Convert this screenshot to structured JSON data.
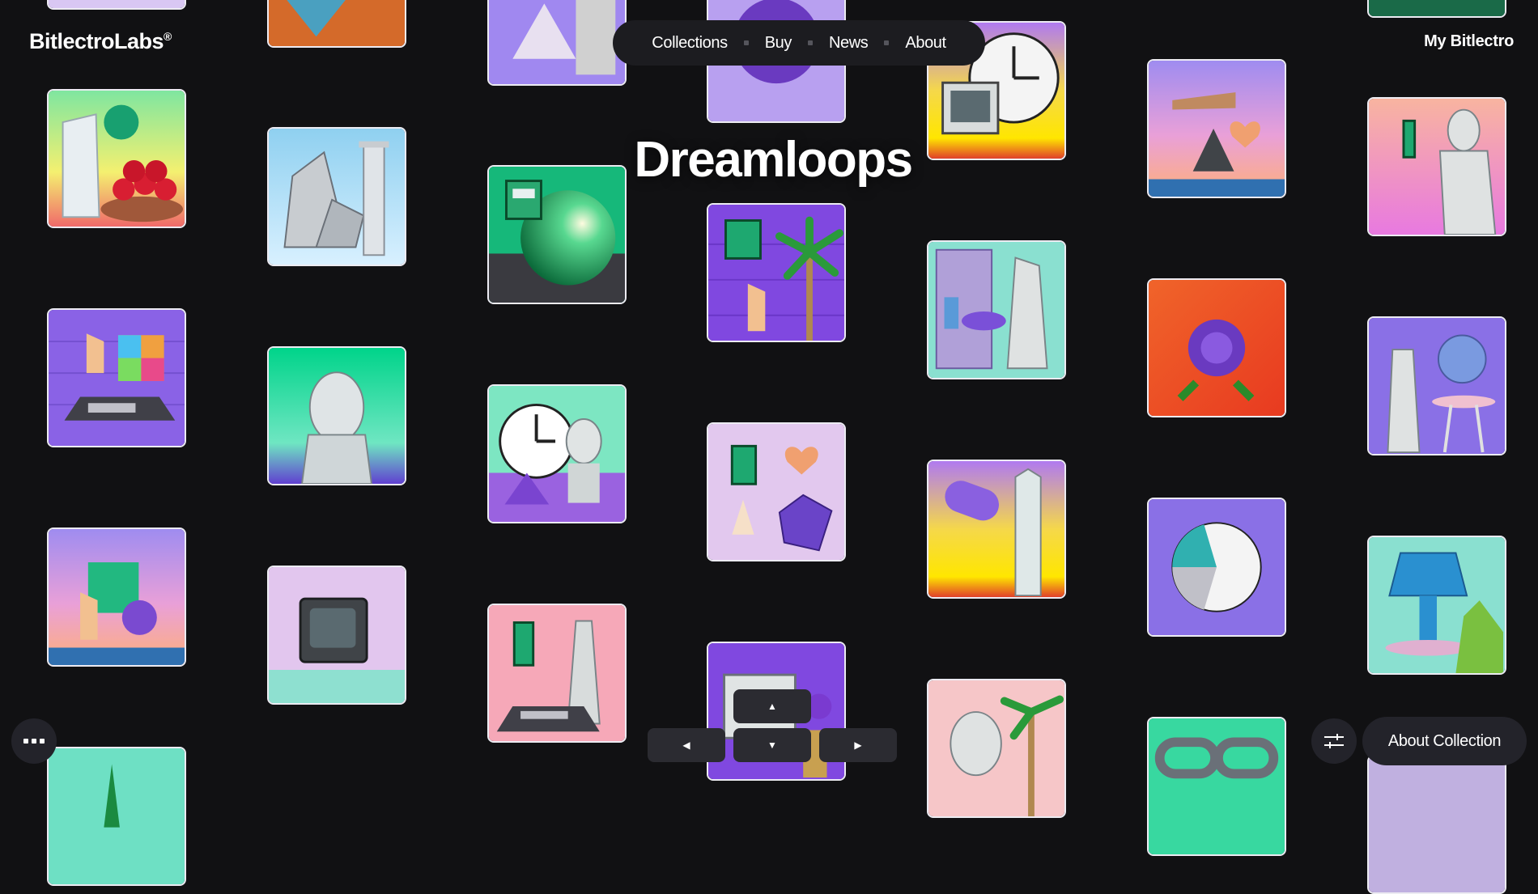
{
  "brand": {
    "name": "BitlectroLabs",
    "mark": "®"
  },
  "nav": {
    "items": [
      {
        "label": "Collections"
      },
      {
        "label": "Buy"
      },
      {
        "label": "News"
      },
      {
        "label": "About"
      }
    ]
  },
  "account_link": "My Bitlectro",
  "collection_title": "Dreamloops",
  "about_collection_label": "About Collection",
  "arrows": {
    "up": "▲",
    "down": "▼",
    "left": "◀",
    "right": "▶"
  },
  "colors": {
    "background": "#111113",
    "tile_border": "#ecebf2",
    "pill_background": "#1c1c20",
    "button_background": "#23232a"
  },
  "artworks": [
    {
      "name": "artwork-fruit-bowl",
      "theme": "ruined column, green orb, bowl of red apples"
    },
    {
      "name": "artwork-rock-column",
      "theme": "rocks and a greek column under a blue sky"
    },
    {
      "name": "artwork-hand-rubiks-cube",
      "theme": "hand, rubik's cube, keyboard on purple brick"
    },
    {
      "name": "artwork-bust-green",
      "theme": "greek bust on green background"
    },
    {
      "name": "artwork-hand-cube-sunset",
      "theme": "hand, green cube and purple sphere at sunset"
    },
    {
      "name": "artwork-crt-monitor",
      "theme": "crt monitor on lavender"
    },
    {
      "name": "artwork-green-sphere",
      "theme": "green glossy sphere with floppy"
    },
    {
      "name": "artwork-clock-bust",
      "theme": "clock, pyramid and bust"
    },
    {
      "name": "artwork-venus-keyboard",
      "theme": "venus statue and keyboard on pink"
    },
    {
      "name": "artwork-palm-hand",
      "theme": "palm tree, hand and floppy on purple brick"
    },
    {
      "name": "artwork-shapes-heart",
      "theme": "heart, cone and crystal with floppy"
    },
    {
      "name": "artwork-computer-flowers",
      "theme": "computer with flowers"
    },
    {
      "name": "artwork-clock-computer",
      "theme": "clock and vintage computer at sunset"
    },
    {
      "name": "artwork-statue-shelf",
      "theme": "statue with cylinders on shelves"
    },
    {
      "name": "artwork-cylinder-obelisk",
      "theme": "cylinder and obelisk at sunset"
    },
    {
      "name": "artwork-statue-palm",
      "theme": "statue head and palm tree"
    },
    {
      "name": "artwork-hand-pyramid-heart",
      "theme": "hand, pyramid and heart over city"
    },
    {
      "name": "artwork-purple-rose",
      "theme": "purple rose on orange"
    },
    {
      "name": "artwork-pie-chart",
      "theme": "pie chart circle on purple"
    },
    {
      "name": "artwork-chain",
      "theme": "chain links on green"
    },
    {
      "name": "artwork-male-statue",
      "theme": "male statue on pink sunset"
    },
    {
      "name": "artwork-venus-sphere",
      "theme": "venus statue with sphere and table"
    },
    {
      "name": "artwork-blue-lamp",
      "theme": "blue lamp and plant"
    }
  ]
}
